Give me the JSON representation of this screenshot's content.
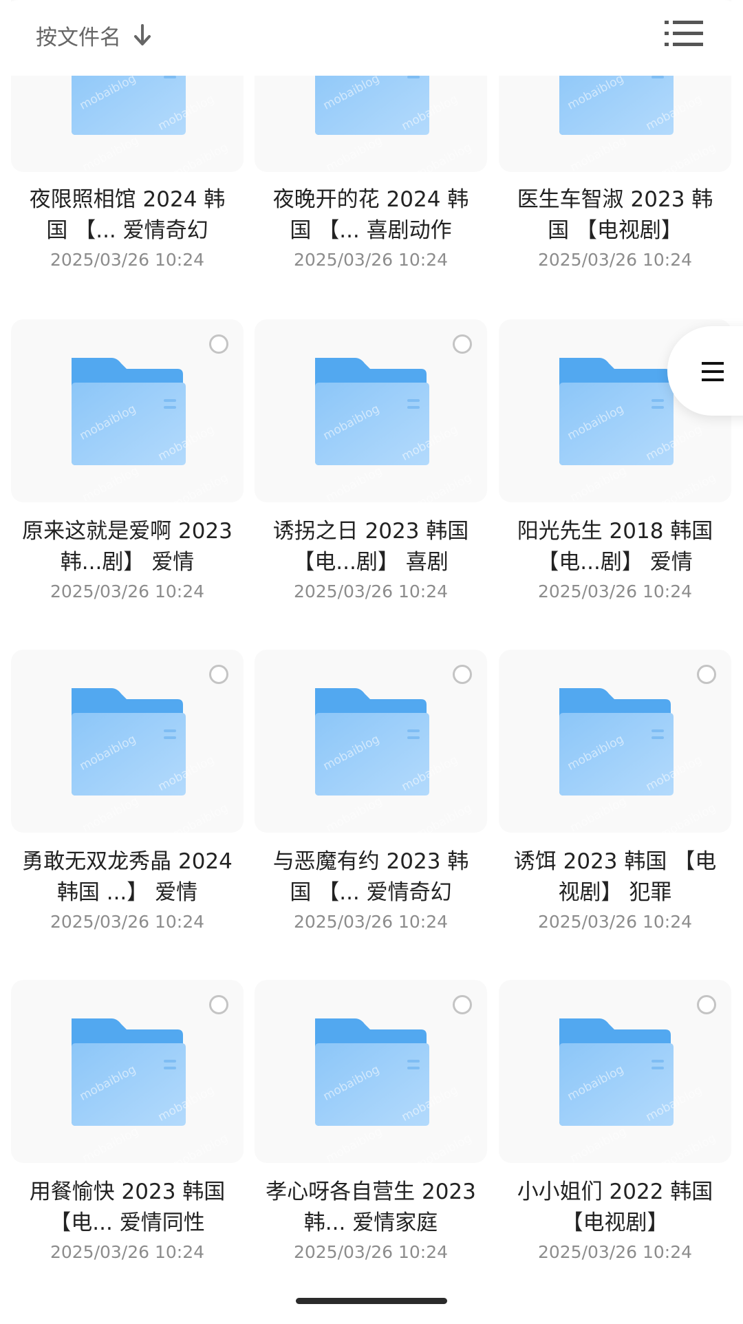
{
  "toolbar": {
    "sort_label": "按文件名",
    "sort_icon": "arrow-down-icon",
    "view_icon": "list-view-icon"
  },
  "side_handle": {
    "icon": "menu-icon"
  },
  "watermark": "mobaiblog",
  "colors": {
    "folder_back": "#4fa9f0",
    "folder_front": "#a7d3fb",
    "tile_bg": "#f9f9f9",
    "text_primary": "#222222",
    "text_secondary": "#8c8c8c"
  },
  "files": [
    {
      "name": "夜限照相馆 2024 韩国 【... 爱情奇幻",
      "date": "2025/03/26 10:24"
    },
    {
      "name": "夜晚开的花 2024 韩国 【... 喜剧动作",
      "date": "2025/03/26 10:24"
    },
    {
      "name": "医生车智淑 2023 韩国 【电视剧】",
      "date": "2025/03/26 10:24"
    },
    {
      "name": "原来这就是爱啊 2023 韩...剧】 爱情",
      "date": "2025/03/26 10:24"
    },
    {
      "name": "诱拐之日 2023 韩国 【电...剧】 喜剧",
      "date": "2025/03/26 10:24"
    },
    {
      "name": "阳光先生 2018 韩国 【电...剧】 爱情",
      "date": "2025/03/26 10:24"
    },
    {
      "name": "勇敢无双龙秀晶 2024 韩国 ...】 爱情",
      "date": "2025/03/26 10:24"
    },
    {
      "name": "与恶魔有约 2023 韩国 【... 爱情奇幻",
      "date": "2025/03/26 10:24"
    },
    {
      "name": "诱饵 2023 韩国 【电视剧】 犯罪",
      "date": "2025/03/26 10:24"
    },
    {
      "name": "用餐愉快 2023 韩国 【电... 爱情同性",
      "date": "2025/03/26 10:24"
    },
    {
      "name": "孝心呀各自营生 2023 韩... 爱情家庭",
      "date": "2025/03/26 10:24"
    },
    {
      "name": "小小姐们 2022 韩国 【电视剧】",
      "date": "2025/03/26 10:24"
    }
  ]
}
